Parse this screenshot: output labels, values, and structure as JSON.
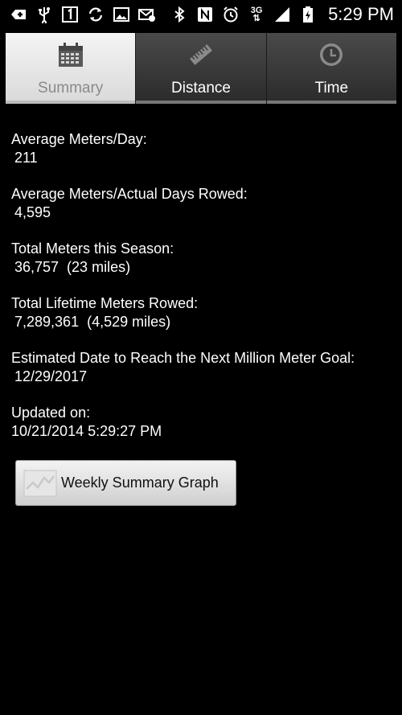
{
  "status_bar": {
    "network": "3G",
    "time": "5:29 PM",
    "left_icons": [
      "plus-box-icon",
      "usb-icon",
      "sim-1-icon",
      "sync-icon",
      "image-icon",
      "email-icon"
    ],
    "right_icons": [
      "bluetooth-icon",
      "nfc-icon",
      "alarm-icon",
      "network-3g-icon",
      "signal-icon",
      "battery-charging-icon"
    ]
  },
  "tabs": [
    {
      "label": "Summary",
      "icon": "calendar-icon",
      "active": true
    },
    {
      "label": "Distance",
      "icon": "ruler-icon",
      "active": false
    },
    {
      "label": "Time",
      "icon": "clock-icon",
      "active": false
    }
  ],
  "stats": {
    "avg_meters_day": {
      "label": "Average Meters/Day:",
      "value": "211"
    },
    "avg_meters_actual": {
      "label": "Average Meters/Actual Days Rowed:",
      "value": "4,595"
    },
    "total_season": {
      "label": "Total Meters this Season:",
      "value": "36,757  (23 miles)"
    },
    "total_lifetime": {
      "label": "Total Lifetime Meters Rowed:",
      "value": "7,289,361  (4,529 miles)"
    },
    "estimated_date": {
      "label": "Estimated Date to Reach the Next Million Meter Goal:",
      "value": "12/29/2017"
    },
    "updated": {
      "label": "Updated on:",
      "value": "10/21/2014 5:29:27 PM"
    }
  },
  "graph_button": {
    "label": "Weekly Summary Graph",
    "icon": "line-graph-icon"
  }
}
